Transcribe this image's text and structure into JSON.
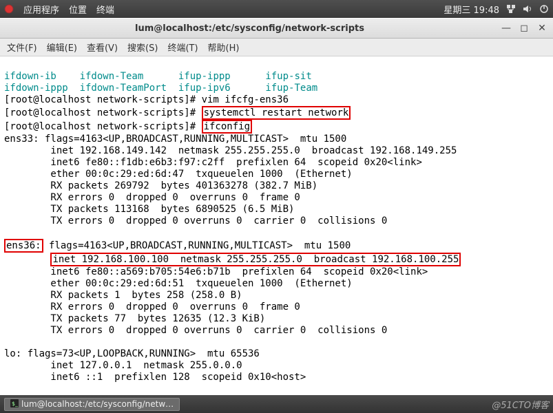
{
  "topbar": {
    "apps": "应用程序",
    "places": "位置",
    "terminal": "终端",
    "clock": "星期三 19:48"
  },
  "window": {
    "title": "lum@localhost:/etc/sysconfig/network-scripts"
  },
  "menu": {
    "file": "文件(F)",
    "edit": "编辑(E)",
    "view": "查看(V)",
    "search": "搜索(S)",
    "terminal": "终端(T)",
    "help": "帮助(H)"
  },
  "term": {
    "cyan1": {
      "c1": "ifdown-ib",
      "c2": "ifdown-Team",
      "c3": "ifup-ippp",
      "c4": "ifup-sit"
    },
    "cyan2": {
      "c1": "ifdown-ippp",
      "c2": "ifdown-TeamPort",
      "c3": "ifup-ipv6",
      "c4": "ifup-Team"
    },
    "l1": "[root@localhost network-scripts]# vim ifcfg-ens36",
    "l2p": "[root@localhost network-scripts]# ",
    "l2box": "systemctl restart network",
    "l3p": "[root@localhost network-scripts]# ",
    "l3box": "ifconfig",
    "ens33_h": "ens33: flags=4163<UP,BROADCAST,RUNNING,MULTICAST>  mtu 1500",
    "ens33_1": "        inet 192.168.149.142  netmask 255.255.255.0  broadcast 192.168.149.255",
    "ens33_2": "        inet6 fe80::f1db:e6b3:f97:c2ff  prefixlen 64  scopeid 0x20<link>",
    "ens33_3": "        ether 00:0c:29:ed:6d:47  txqueuelen 1000  (Ethernet)",
    "ens33_4": "        RX packets 269792  bytes 401363278 (382.7 MiB)",
    "ens33_5": "        RX errors 0  dropped 0  overruns 0  frame 0",
    "ens33_6": "        TX packets 113168  bytes 6890525 (6.5 MiB)",
    "ens33_7": "        TX errors 0  dropped 0 overruns 0  carrier 0  collisions 0",
    "ens36_label": "ens36:",
    "ens36_h": " flags=4163<UP,BROADCAST,RUNNING,MULTICAST>  mtu 1500",
    "ens36_1": "inet 192.168.100.100  netmask 255.255.255.0  broadcast 192.168.100.255",
    "ens36_2": "        inet6 fe80::a569:b705:54e6:b71b  prefixlen 64  scopeid 0x20<link>",
    "ens36_3": "        ether 00:0c:29:ed:6d:51  txqueuelen 1000  (Ethernet)",
    "ens36_4": "        RX packets 1  bytes 258 (258.0 B)",
    "ens36_5": "        RX errors 0  dropped 0  overruns 0  frame 0",
    "ens36_6": "        TX packets 77  bytes 12635 (12.3 KiB)",
    "ens36_7": "        TX errors 0  dropped 0 overruns 0  carrier 0  collisions 0",
    "lo_h": "lo: flags=73<UP,LOOPBACK,RUNNING>  mtu 65536",
    "lo_1": "        inet 127.0.0.1  netmask 255.0.0.0",
    "lo_2": "        inet6 ::1  prefixlen 128  scopeid 0x10<host>"
  },
  "taskbar": {
    "task1": "lum@localhost:/etc/sysconfig/netw…",
    "watermark": "@51CTO博客"
  }
}
